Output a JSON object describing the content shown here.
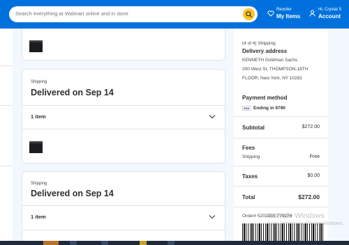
{
  "header": {
    "search_placeholder": "Search everything at Walmart online and in store",
    "reorder_small": "Reorder",
    "reorder_big": "My Items",
    "account_small": "Hi, Crystal S",
    "account_big": "Account"
  },
  "shipments": [
    {
      "label": "Shipping",
      "title": "Delivered on Sep 14",
      "items": "1 item"
    },
    {
      "label": "Shipping",
      "title": "Delivered on Sep 14",
      "items": "1 item"
    }
  ],
  "summary": {
    "shipping_count": "(4 of 4) Shipping",
    "delivery_heading": "Delivery address",
    "address_line1": "KENNETH Goldman Sachs",
    "address_line2": "200 West St, THOMPSON-18TH",
    "address_line3": "FLOOR, New York, NY 10282",
    "payment_heading": "Payment method",
    "card_brand": "VISA",
    "card_text": "Ending in 9790",
    "subtotal_label": "Subtotal",
    "subtotal_value": "$272.00",
    "fees_heading": "Fees",
    "shipping_label": "Shipping",
    "shipping_value": "Free",
    "taxes_label": "Taxes",
    "taxes_value": "$0.00",
    "total_label": "Total",
    "total_value": "$272.00",
    "order_number": "Order# 5202155-779274"
  },
  "watermark": {
    "line1": "Activate Windows",
    "line2": "Go to Settings to activate Windows."
  },
  "colors": {
    "brand_blue": "#0071dc",
    "spark_yellow": "#ffc220",
    "page_bg": "#f2f8fd"
  }
}
